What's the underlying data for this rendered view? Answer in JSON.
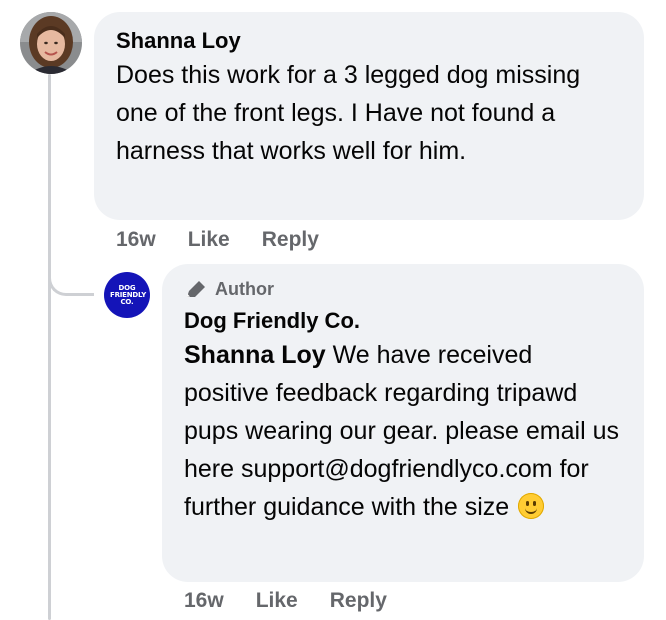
{
  "comment": {
    "author": "Shanna Loy",
    "text": "Does this work for a 3 legged dog missing one of the front legs. I Have not found a harness that works well for him.",
    "time": "16w",
    "like_label": "Like",
    "reply_label": "Reply"
  },
  "reply": {
    "badge_label": "Author",
    "author": "Dog Friendly Co.",
    "avatar_text": "DOG FRIENDLY CO.",
    "mention": "Shanna Loy",
    "text": " We have received positive feedback regarding tripawd pups wearing our gear. please email us here support@dogfriendlyco.com for further guidance with the size",
    "emoji": "slightly-smiling-face",
    "time": "16w",
    "like_label": "Like",
    "reply_label": "Reply"
  },
  "colors": {
    "bubble": "#f0f2f5",
    "meta": "#65676b",
    "brand": "#1414b8",
    "thread_line": "#ced0d4"
  }
}
